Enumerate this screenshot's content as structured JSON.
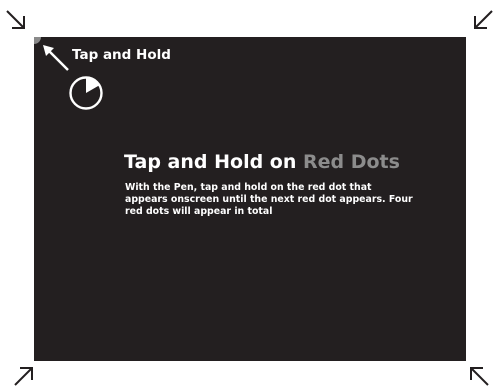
{
  "hint": {
    "label": "Tap and Hold"
  },
  "title": {
    "main": "Tap and Hold on",
    "accent": "Red Dots"
  },
  "instructions": {
    "text": "With the Pen, tap and hold on the red dot that appears onscreen until the next red dot appears. Four red dots will appear in total"
  },
  "icons": {
    "corner_top_left": "arrow-down-right-icon",
    "corner_top_right": "arrow-down-left-icon",
    "corner_bottom_left": "arrow-up-right-icon",
    "corner_bottom_right": "arrow-up-left-icon",
    "hint_arrow": "arrow-up-left-icon",
    "timer": "timer-icon"
  },
  "colors": {
    "screen_background": "#231f20",
    "title_accent": "#8c8c8c",
    "text": "#ffffff",
    "target_dot": "#8a8a8a"
  }
}
